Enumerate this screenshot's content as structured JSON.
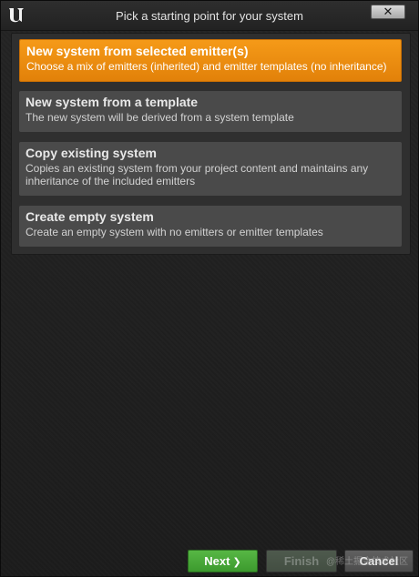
{
  "window": {
    "title": "Pick a starting point for your system",
    "close_label": "✕"
  },
  "options": [
    {
      "title": "New system from selected emitter(s)",
      "description": "Choose a mix of emitters (inherited) and emitter templates (no inheritance)",
      "selected": true
    },
    {
      "title": "New system from a template",
      "description": "The new system will be derived from a system template",
      "selected": false
    },
    {
      "title": "Copy existing system",
      "description": "Copies an existing system from your project content and maintains any inheritance of the included emitters",
      "selected": false
    },
    {
      "title": "Create empty system",
      "description": "Create an empty system with no emitters or emitter templates",
      "selected": false
    }
  ],
  "footer": {
    "next_label": "Next",
    "finish_label": "Finish",
    "cancel_label": "Cancel"
  },
  "watermark": "@稀土掘金技术社区",
  "colors": {
    "selected_accent": "#f08c10",
    "next_button": "#48a838",
    "option_background": "#4a4a4a",
    "window_background": "#1f1f1f"
  },
  "icons": {
    "logo": "unreal-engine-logo-icon",
    "close": "close-icon",
    "next_chevron": "chevron-right-icon"
  }
}
